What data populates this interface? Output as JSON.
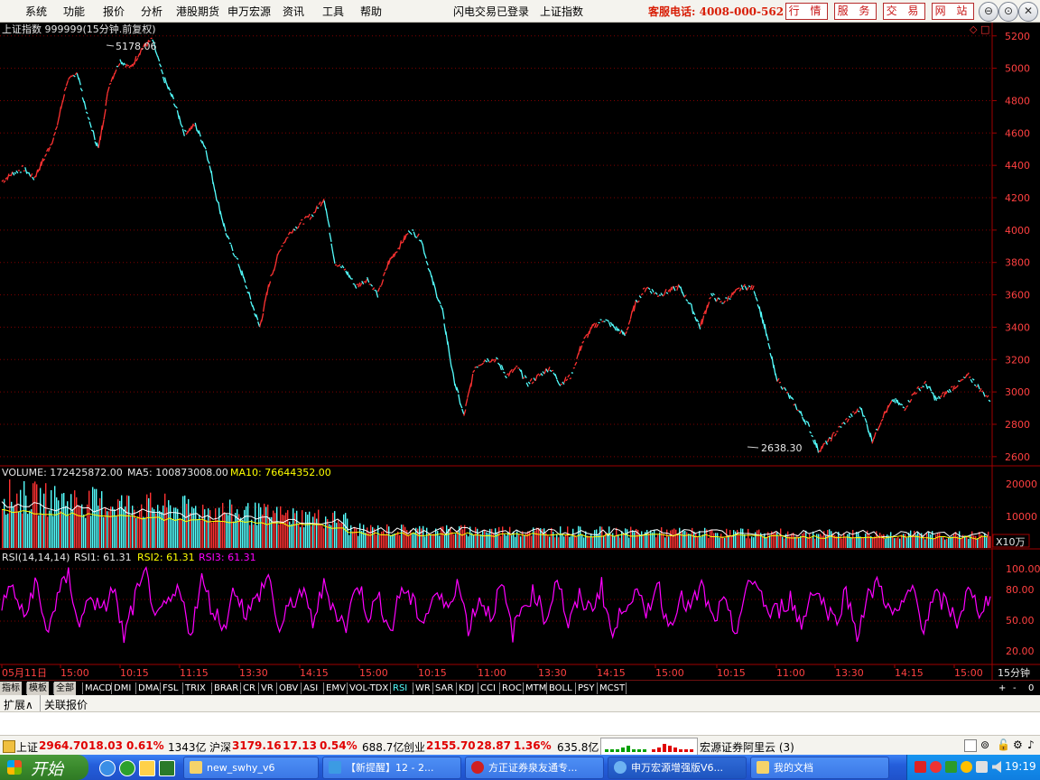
{
  "menubar": {
    "items": [
      "系统",
      "功能",
      "报价",
      "分析",
      "港股期货",
      "申万宏源",
      "资讯",
      "工具",
      "帮助"
    ],
    "status_login": "闪电交易已登录",
    "current_symbol": "上证指数",
    "hotline": "客服电话: 4008-000-562",
    "red_buttons": [
      "行 情",
      "服 务",
      "交 易",
      "网 站"
    ],
    "window_buttons": [
      "⊖",
      "⊙",
      "✕"
    ]
  },
  "main_chart": {
    "title": "上证指数 999999(15分钟.前复权)",
    "high_label": "5178.06",
    "low_label": "2638.30",
    "y_ticks": [
      "5200",
      "5000",
      "4800",
      "4600",
      "4400",
      "4200",
      "4000",
      "3800",
      "3600",
      "3400",
      "3200",
      "3000",
      "2800",
      "2600"
    ],
    "corner_icons": [
      "◇",
      "□"
    ]
  },
  "volume_panel": {
    "label_volume": "VOLUME: 172425872.00",
    "label_ma5": "MA5: 100873008.00",
    "label_ma10": "MA10: 76644352.00",
    "y_ticks": [
      "20000",
      "10000"
    ],
    "unit": "X10万"
  },
  "rsi_panel": {
    "label_name": "RSI(14,14,14)",
    "label_rsi1": "RSI1: 61.31",
    "label_rsi2": "RSI2: 61.31",
    "label_rsi3": "RSI3: 61.31",
    "y_ticks": [
      "100.00",
      "80.00",
      "50.00",
      "20.00"
    ]
  },
  "time_axis": {
    "labels": [
      "05月11日",
      "15:00",
      "10:15",
      "11:15",
      "13:30",
      "14:15",
      "15:00",
      "10:15",
      "11:00",
      "13:30",
      "14:15",
      "15:00",
      "10:15",
      "11:00",
      "13:30",
      "14:15",
      "15:00"
    ],
    "period": "15分钟"
  },
  "tabs": {
    "items": [
      "指标",
      "模板",
      "全部",
      "MACD",
      "DMI",
      "DMA",
      "FSL",
      "TRIX",
      "BRAR",
      "CR",
      "VR",
      "OBV",
      "ASI",
      "EMV",
      "VOL-TDX",
      "RSI",
      "WR",
      "SAR",
      "KDJ",
      "CCI",
      "ROC",
      "MTM",
      "BOLL",
      "PSY",
      "MCST"
    ],
    "active": "RSI",
    "right_controls": [
      "+",
      "-",
      "0"
    ]
  },
  "extbar": {
    "items": [
      "扩展∧",
      "关联报价"
    ]
  },
  "statusbar": {
    "sh_label": "上证",
    "sh_value": "2964.70",
    "sh_change": "18.03",
    "sh_pct": "0.61%",
    "sh_amount": "1343亿",
    "hs_label": "沪深",
    "hs_value": "3179.16",
    "hs_change": "17.13",
    "hs_pct": "0.54%",
    "hs_amount": "688.7亿",
    "cy_label": "创业",
    "cy_value": "2155.70",
    "cy_change": "28.87",
    "cy_pct": "1.36%",
    "cy_amount": "635.8亿",
    "server": "宏源证券阿里云 (3)"
  },
  "taskbar": {
    "start": "开始",
    "tasks": [
      "new_swhy_v6",
      "【新提醒】12 - 2...",
      "方正证券泉友通专...",
      "申万宏源增强版V6...",
      "我的文档"
    ],
    "clock": "19:19"
  },
  "colors": {
    "up": "#ff3232",
    "down": "#54ffff",
    "ma5": "#ffffff",
    "ma10": "#ffff00",
    "rsi": "#ff00ff",
    "grid": "#800000",
    "axis_text": "#ff4040"
  },
  "chart_data": {
    "type": "line",
    "title": "上证指数 999999(15分钟.前复权)",
    "ylim": [
      2560,
      5260
    ],
    "series": [
      {
        "values": [
          4300,
          4350,
          4380,
          4320,
          4450,
          4600,
          4900,
          4980,
          4700,
          4500,
          4900,
          5050,
          5000,
          5120,
          5178.06,
          4950,
          4800,
          4600,
          4650,
          4500,
          4200,
          3950,
          3800,
          3600,
          3400,
          3700,
          3900,
          4000,
          4050,
          4100,
          4200,
          3800,
          3750,
          3650,
          3700,
          3600,
          3800,
          3900,
          4000,
          3950,
          3700,
          3500,
          3100,
          2850,
          3150,
          3200,
          3200,
          3100,
          3150,
          3050,
          3100,
          3150,
          3050,
          3100,
          3300,
          3400,
          3450,
          3400,
          3350,
          3550,
          3650,
          3600,
          3620,
          3650,
          3550,
          3400,
          3600,
          3550,
          3600,
          3650,
          3640,
          3400,
          3100,
          3000,
          2900,
          2800,
          2638.3,
          2700,
          2780,
          2850,
          2900,
          2700,
          2850,
          2950,
          2900,
          3000,
          3050,
          2950,
          3000,
          3050,
          3100,
          3020,
          2950
        ]
      },
      {
        "name": "RSI1",
        "values": [
          55,
          70,
          40,
          75,
          30,
          60,
          80,
          35,
          65,
          45,
          70,
          25,
          60,
          80,
          40,
          55,
          65,
          30,
          75,
          50,
          35,
          70,
          45,
          60,
          80,
          30,
          55,
          65,
          40,
          70,
          50,
          35,
          75,
          45,
          60,
          30,
          70,
          55,
          40,
          65,
          50,
          75,
          35,
          60,
          45,
          70,
          30,
          55,
          65,
          40,
          80,
          35,
          60,
          50,
          70,
          25,
          55,
          65,
          45,
          75,
          35,
          60,
          50,
          70,
          40,
          55,
          30,
          65,
          75,
          45,
          50,
          60,
          35,
          70,
          55,
          40,
          65,
          30,
          60,
          75,
          45,
          50,
          70,
          35,
          60,
          55,
          40,
          65,
          50,
          61.31
        ]
      }
    ]
  }
}
